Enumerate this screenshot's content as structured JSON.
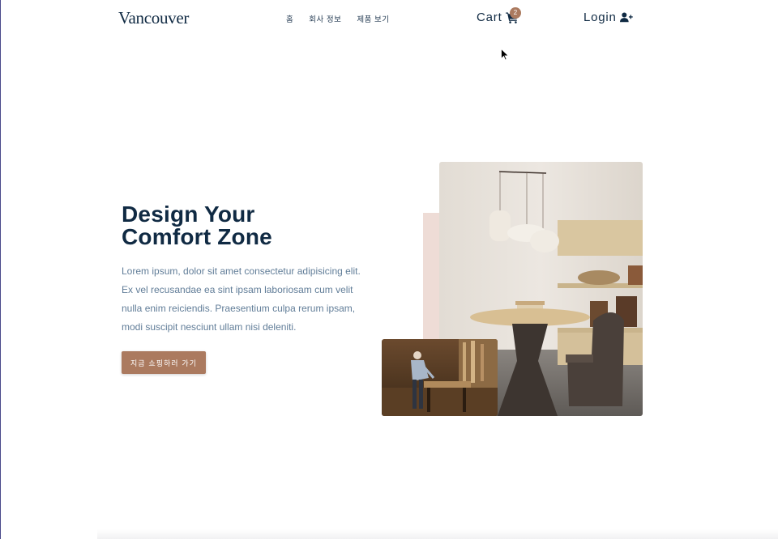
{
  "header": {
    "logo": "Vancouver",
    "nav": [
      "홈",
      "회사 정보",
      "제품 보기"
    ],
    "cart_label": "Cart",
    "cart_count": "2",
    "login_label": "Login"
  },
  "hero": {
    "title_line1": "Design Your",
    "title_line2": "Comfort Zone",
    "text": "Lorem ipsum, dolor sit amet consectetur adipisicing elit. Ex vel recusandae ea sint ipsam laboriosam cum velit nulla enim reiciendis. Praesentium culpa rerum ipsam, modi suscipit nesciunt ullam nisi deleniti.",
    "cta_label": "지금 쇼핑하러 가기"
  },
  "colors": {
    "primary": "#ab7a5f",
    "heading": "#102a43",
    "body_text": "#617d98",
    "accent_light": "#eedcd6"
  },
  "icons": {
    "cart": "shopping-cart-icon",
    "login": "user-plus-icon"
  },
  "images": {
    "main": "dining room interior photo",
    "small": "carpenter workshop photo"
  }
}
